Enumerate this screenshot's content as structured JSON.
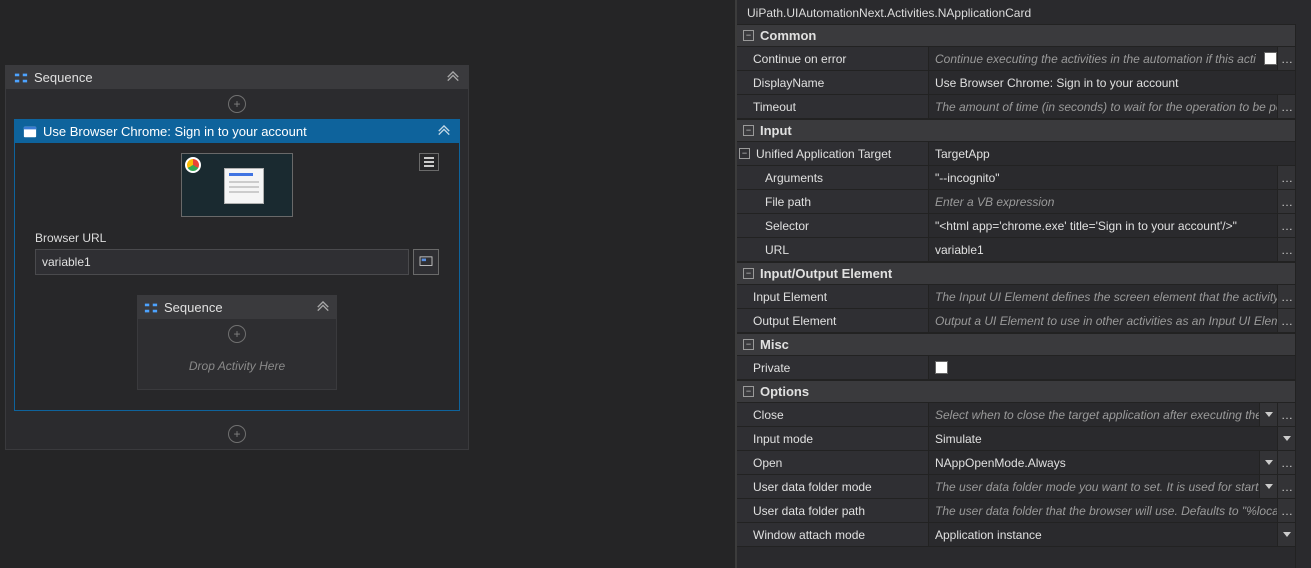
{
  "left": {
    "outer_sequence": "Sequence",
    "activity_title": "Use Browser Chrome: Sign in to your account",
    "field_label": "Browser URL",
    "field_value": "variable1",
    "inner_sequence": "Sequence",
    "drop_hint": "Drop Activity Here"
  },
  "props": {
    "type_path": "UiPath.UIAutomationNext.Activities.NApplicationCard",
    "groups": {
      "common": "Common",
      "input": "Input",
      "io_element": "Input/Output Element",
      "misc": "Misc",
      "options": "Options"
    },
    "common": {
      "continue_on_error": {
        "label": "Continue on error",
        "placeholder": "Continue executing the activities in the automation if this acti"
      },
      "display_name": {
        "label": "DisplayName",
        "value": "Use Browser Chrome: Sign in to your account"
      },
      "timeout": {
        "label": "Timeout",
        "placeholder": "The amount of time (in seconds) to wait for the operation to be pe"
      }
    },
    "input": {
      "uat": {
        "label": "Unified Application Target",
        "value": "TargetApp"
      },
      "arguments": {
        "label": "Arguments",
        "value": "\"--incognito\""
      },
      "file_path": {
        "label": "File path",
        "placeholder": "Enter a VB expression"
      },
      "selector": {
        "label": "Selector",
        "value": "\"<html app='chrome.exe' title='Sign in to your account'/>\""
      },
      "url": {
        "label": "URL",
        "value": "variable1"
      }
    },
    "io": {
      "input_element": {
        "label": "Input Element",
        "placeholder": "The Input UI Element defines the screen element that the activity"
      },
      "output_element": {
        "label": "Output Element",
        "placeholder": "Output a UI Element to use in other activities as an Input UI Elem"
      }
    },
    "misc": {
      "private": {
        "label": "Private"
      }
    },
    "options": {
      "close": {
        "label": "Close",
        "placeholder": "Select when to close the target application after executing the"
      },
      "input_mode": {
        "label": "Input mode",
        "value": "Simulate"
      },
      "open": {
        "label": "Open",
        "value": "NAppOpenMode.Always"
      },
      "udf_mode": {
        "label": "User data folder mode",
        "placeholder": "The user data folder mode you want to set. It is used for starti"
      },
      "udf_path": {
        "label": "User data folder path",
        "placeholder": "The user data folder that the browser will use. Defaults to \"%local"
      },
      "window_attach": {
        "label": "Window attach mode",
        "value": "Application instance"
      }
    }
  }
}
